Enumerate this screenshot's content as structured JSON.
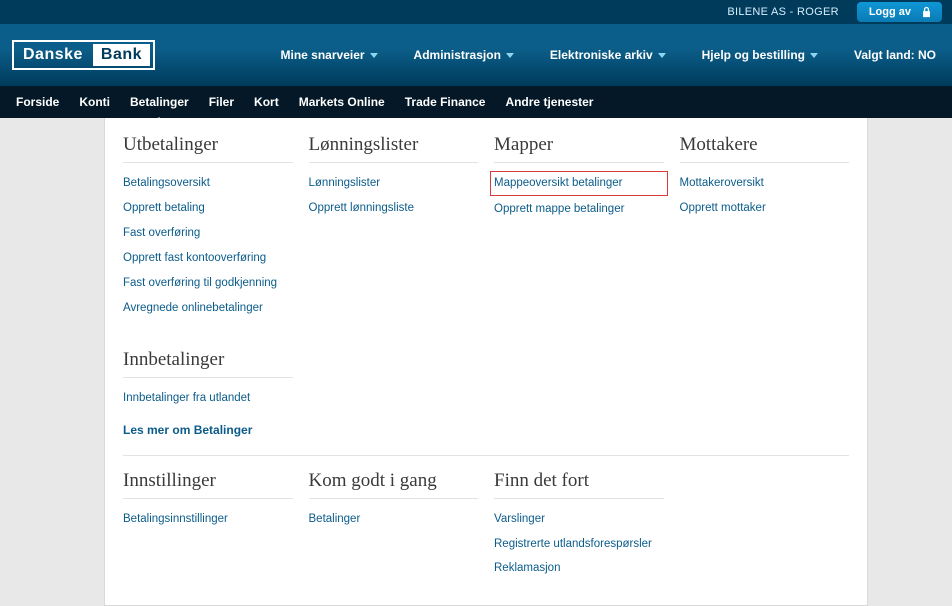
{
  "topbar": {
    "user_label": "BILENE AS - ROGER",
    "logout_label": "Logg av"
  },
  "logo": {
    "left": "Danske",
    "right": "Bank"
  },
  "main_nav": {
    "items": [
      {
        "label": "Mine snarveier"
      },
      {
        "label": "Administrasjon"
      },
      {
        "label": "Elektroniske arkiv"
      },
      {
        "label": "Hjelp og bestilling"
      }
    ],
    "country": "Valgt land: NO"
  },
  "sub_nav": [
    "Forside",
    "Konti",
    "Betalinger",
    "Filer",
    "Kort",
    "Markets Online",
    "Trade Finance",
    "Andre tjenester"
  ],
  "mega": {
    "row1": {
      "c0": {
        "title": "Utbetalinger",
        "links": [
          "Betalingsoversikt",
          "Opprett betaling",
          "Fast overføring",
          "Opprett fast kontooverføring",
          "Fast overføring til godkjenning",
          "Avregnede onlinebetalinger"
        ],
        "title2": "Innbetalinger",
        "links2": [
          "Innbetalinger fra utlandet"
        ],
        "more": "Les mer om Betalinger"
      },
      "c1": {
        "title": "Lønningslister",
        "links": [
          "Lønningslister",
          "Opprett lønningsliste"
        ]
      },
      "c2": {
        "title": "Mapper",
        "links": [
          "Mappeoversikt betalinger",
          "Opprett mappe betalinger"
        ]
      },
      "c3": {
        "title": "Mottakere",
        "links": [
          "Mottakeroversikt",
          "Opprett mottaker"
        ]
      }
    },
    "row2": {
      "c0": {
        "title": "Innstillinger",
        "links": [
          "Betalingsinnstillinger"
        ]
      },
      "c1": {
        "title": "Kom godt i gang",
        "links": [
          "Betalinger"
        ]
      },
      "c2": {
        "title": "Finn det fort",
        "links": [
          "Varslinger",
          "Registrerte utlandsforespørsler",
          "Reklamasjon"
        ]
      }
    }
  }
}
